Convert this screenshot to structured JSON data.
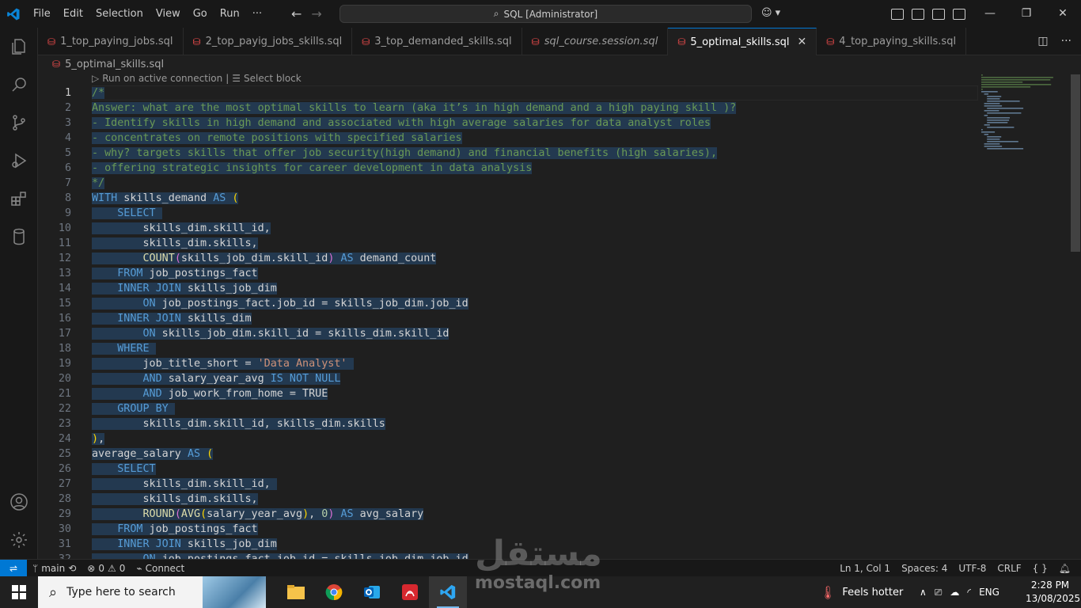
{
  "menu": [
    "File",
    "Edit",
    "Selection",
    "View",
    "Go",
    "Run",
    "···"
  ],
  "command_center": "SQL [Administrator]",
  "tabs": [
    {
      "label": "1_top_paying_jobs.sql",
      "active": false,
      "italic": false
    },
    {
      "label": "2_top_payig_jobs_skills.sql",
      "active": false,
      "italic": false
    },
    {
      "label": "3_top_demanded_skills.sql",
      "active": false,
      "italic": false
    },
    {
      "label": "sql_course.session.sql",
      "active": false,
      "italic": true
    },
    {
      "label": "5_optimal_skills.sql",
      "active": true,
      "italic": false
    },
    {
      "label": "4_top_paying_skills.sql",
      "active": false,
      "italic": false
    }
  ],
  "breadcrumb": "5_optimal_skills.sql",
  "codelens": {
    "run": "Run on active connection",
    "select": "Select block"
  },
  "code_lines": [
    [
      [
        "c",
        "/*"
      ]
    ],
    [
      [
        "c",
        "Answer: what are the most optimal skills to learn (aka it’s in high demand and a high paying skill )?"
      ]
    ],
    [
      [
        "c",
        "- Identify skills in high demand and associated with high average salaries for data analyst roles"
      ]
    ],
    [
      [
        "c",
        "- concentrates on remote positions with specified salaries"
      ]
    ],
    [
      [
        "c",
        "- why? targets skills that offer job security(high demand) and financial benefits (high salaries),"
      ]
    ],
    [
      [
        "c",
        "- offering strategic insights for career development in data analysis"
      ]
    ],
    [
      [
        "c",
        "*/"
      ]
    ],
    [
      [
        "k",
        "WITH"
      ],
      [
        "t",
        " skills_demand "
      ],
      [
        "k",
        "AS"
      ],
      [
        "t",
        " "
      ],
      [
        "p",
        "("
      ]
    ],
    [
      [
        "t",
        "    "
      ],
      [
        "k",
        "SELECT"
      ],
      [
        "t",
        " "
      ]
    ],
    [
      [
        "t",
        "        skills_dim.skill_id,"
      ]
    ],
    [
      [
        "t",
        "        skills_dim.skills,"
      ]
    ],
    [
      [
        "t",
        "        "
      ],
      [
        "f",
        "COUNT"
      ],
      [
        "pl",
        "("
      ],
      [
        "t",
        "skills_job_dim.skill_id"
      ],
      [
        "pl",
        ")"
      ],
      [
        "t",
        " "
      ],
      [
        "k",
        "AS"
      ],
      [
        "t",
        " demand_count"
      ]
    ],
    [
      [
        "t",
        "    "
      ],
      [
        "k",
        "FROM"
      ],
      [
        "t",
        " job_postings_fact"
      ]
    ],
    [
      [
        "t",
        "    "
      ],
      [
        "k",
        "INNER JOIN"
      ],
      [
        "t",
        " skills_job_dim"
      ]
    ],
    [
      [
        "t",
        "        "
      ],
      [
        "k",
        "ON"
      ],
      [
        "t",
        " job_postings_fact.job_id = skills_job_dim.job_id"
      ]
    ],
    [
      [
        "t",
        "    "
      ],
      [
        "k",
        "INNER JOIN"
      ],
      [
        "t",
        " skills_dim"
      ]
    ],
    [
      [
        "t",
        "        "
      ],
      [
        "k",
        "ON"
      ],
      [
        "t",
        " skills_job_dim.skill_id = skills_dim.skill_id"
      ]
    ],
    [
      [
        "t",
        "    "
      ],
      [
        "k",
        "WHERE"
      ],
      [
        "t",
        " "
      ]
    ],
    [
      [
        "t",
        "        job_title_short = "
      ],
      [
        "s",
        "'Data Analyst'"
      ],
      [
        "t",
        " "
      ]
    ],
    [
      [
        "t",
        "        "
      ],
      [
        "k",
        "AND"
      ],
      [
        "t",
        " salary_year_avg "
      ],
      [
        "k",
        "IS NOT NULL"
      ]
    ],
    [
      [
        "t",
        "        "
      ],
      [
        "k",
        "AND"
      ],
      [
        "t",
        " job_work_from_home = TRUE"
      ]
    ],
    [
      [
        "t",
        "    "
      ],
      [
        "k",
        "GROUP BY"
      ],
      [
        "t",
        " "
      ]
    ],
    [
      [
        "t",
        "        skills_dim.skill_id, skills_dim.skills"
      ]
    ],
    [
      [
        "p",
        ")"
      ],
      [
        "t",
        ","
      ]
    ],
    [
      [
        "t",
        "average_salary "
      ],
      [
        "k",
        "AS"
      ],
      [
        "t",
        " "
      ],
      [
        "p",
        "("
      ]
    ],
    [
      [
        "t",
        "    "
      ],
      [
        "k",
        "SELECT"
      ]
    ],
    [
      [
        "t",
        "        skills_dim.skill_id, "
      ]
    ],
    [
      [
        "t",
        "        skills_dim.skills,"
      ]
    ],
    [
      [
        "t",
        "        "
      ],
      [
        "f",
        "ROUND"
      ],
      [
        "pl",
        "("
      ],
      [
        "f",
        "AVG"
      ],
      [
        "p",
        "("
      ],
      [
        "t",
        "salary_year_avg"
      ],
      [
        "p",
        ")"
      ],
      [
        "t",
        ", "
      ],
      [
        "n",
        "0"
      ],
      [
        "pl",
        ")"
      ],
      [
        "t",
        " "
      ],
      [
        "k",
        "AS"
      ],
      [
        "t",
        " avg_salary"
      ]
    ],
    [
      [
        "t",
        "    "
      ],
      [
        "k",
        "FROM"
      ],
      [
        "t",
        " job_postings_fact"
      ]
    ],
    [
      [
        "t",
        "    "
      ],
      [
        "k",
        "INNER JOIN"
      ],
      [
        "t",
        " skills_job_dim"
      ]
    ],
    [
      [
        "t",
        "        "
      ],
      [
        "k",
        "ON"
      ],
      [
        "t",
        " job_postings_fact.job_id = skills_job_dim.job_id"
      ]
    ]
  ],
  "status": {
    "branch": "main",
    "problems": "0",
    "warnings": "0",
    "connect": "Connect",
    "position": "Ln 1, Col 1",
    "spaces": "Spaces: 4",
    "encoding": "UTF-8",
    "eol": "CRLF",
    "lang": "{ }"
  },
  "taskbar": {
    "search_placeholder": "Type here to search",
    "weather": "Feels hotter",
    "lang": "ENG",
    "time": "2:28 PM",
    "date": "13/08/2025"
  },
  "watermark": {
    "arabic": "مستقل",
    "latin": "mostaql.com"
  },
  "colors": {
    "accent": "#0078d4",
    "comment": "#6a9955",
    "keyword": "#569cd6"
  }
}
